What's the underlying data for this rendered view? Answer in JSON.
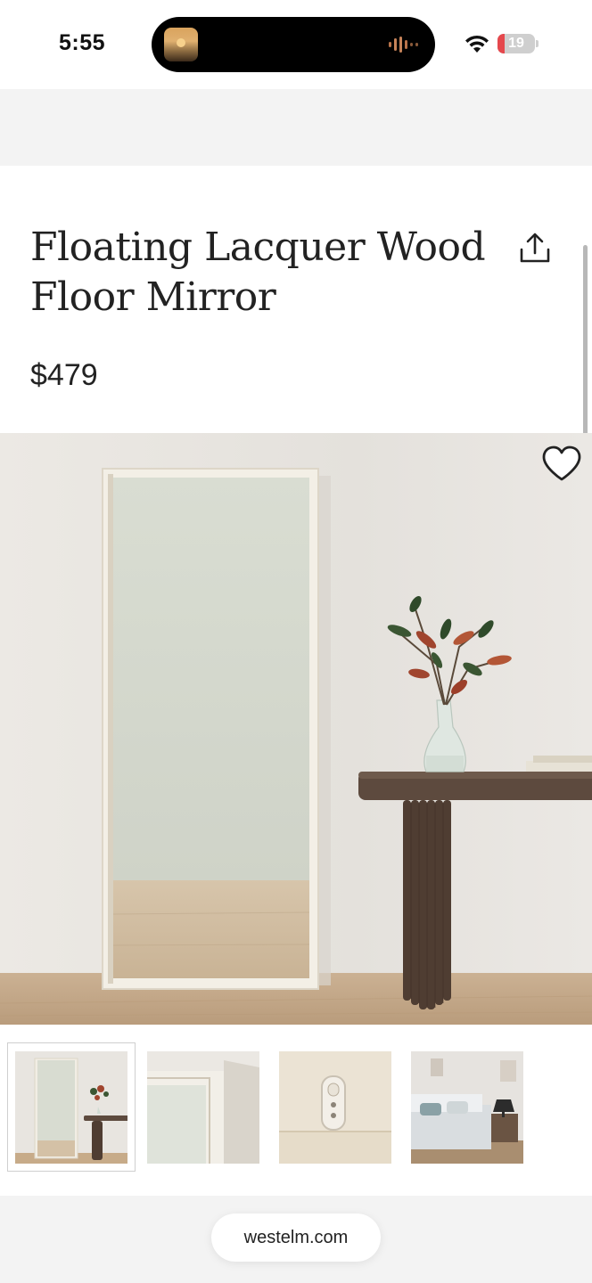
{
  "status_bar": {
    "time": "5:55",
    "battery_level": "19",
    "icons": [
      "media-thumbnail-icon",
      "audio-wave-icon",
      "wifi-icon",
      "battery-icon"
    ]
  },
  "product": {
    "title": "Floating Lacquer Wood Floor Mirror",
    "price": "$479",
    "share_icon": "share-icon",
    "favorite_icon": "heart-icon"
  },
  "gallery": {
    "selected_index": 0,
    "thumbnails": [
      "thumb-mirror-console",
      "thumb-mirror-corner",
      "thumb-wall-bracket",
      "thumb-bedroom"
    ]
  },
  "browser": {
    "url": "westelm.com"
  },
  "colors": {
    "battery_low": "#e5484d",
    "wall": "#e9e7e3",
    "floor": "#c9ad8c",
    "frame": "#f1ede4",
    "wood": "#5a463a"
  }
}
